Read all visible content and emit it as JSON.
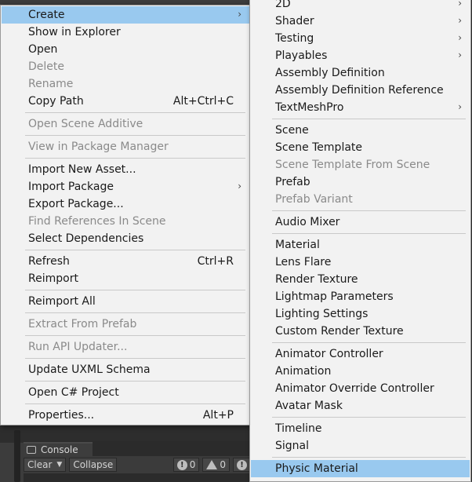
{
  "main_menu": {
    "items": [
      {
        "label": "Create",
        "arrow": "›",
        "highlighted": true
      },
      {
        "label": "Show in Explorer"
      },
      {
        "label": "Open"
      },
      {
        "label": "Delete",
        "disabled": true
      },
      {
        "label": "Rename",
        "disabled": true
      },
      {
        "label": "Copy Path",
        "shortcut": "Alt+Ctrl+C"
      },
      {
        "label": "Open Scene Additive",
        "disabled": true
      },
      {
        "label": "View in Package Manager",
        "disabled": true
      },
      {
        "label": "Import New Asset..."
      },
      {
        "label": "Import Package",
        "arrow": "›"
      },
      {
        "label": "Export Package..."
      },
      {
        "label": "Find References In Scene",
        "disabled": true
      },
      {
        "label": "Select Dependencies"
      },
      {
        "label": "Refresh",
        "shortcut": "Ctrl+R"
      },
      {
        "label": "Reimport"
      },
      {
        "label": "Reimport All"
      },
      {
        "label": "Extract From Prefab",
        "disabled": true
      },
      {
        "label": "Run API Updater...",
        "disabled": true
      },
      {
        "label": "Update UXML Schema"
      },
      {
        "label": "Open C# Project"
      },
      {
        "label": "Properties...",
        "shortcut": "Alt+P"
      }
    ]
  },
  "sub_menu": {
    "items": [
      {
        "label": "2D",
        "arrow": "›"
      },
      {
        "label": "Shader",
        "arrow": "›"
      },
      {
        "label": "Testing",
        "arrow": "›"
      },
      {
        "label": "Playables",
        "arrow": "›"
      },
      {
        "label": "Assembly Definition"
      },
      {
        "label": "Assembly Definition Reference"
      },
      {
        "label": "TextMeshPro",
        "arrow": "›"
      },
      {
        "label": "Scene"
      },
      {
        "label": "Scene Template"
      },
      {
        "label": "Scene Template From Scene",
        "disabled": true
      },
      {
        "label": "Prefab"
      },
      {
        "label": "Prefab Variant",
        "disabled": true
      },
      {
        "label": "Audio Mixer"
      },
      {
        "label": "Material"
      },
      {
        "label": "Lens Flare"
      },
      {
        "label": "Render Texture"
      },
      {
        "label": "Lightmap Parameters"
      },
      {
        "label": "Lighting Settings"
      },
      {
        "label": "Custom Render Texture"
      },
      {
        "label": "Animator Controller"
      },
      {
        "label": "Animation"
      },
      {
        "label": "Animator Override Controller"
      },
      {
        "label": "Avatar Mask"
      },
      {
        "label": "Timeline"
      },
      {
        "label": "Signal"
      },
      {
        "label": "Physic Material",
        "highlighted": true
      }
    ]
  },
  "console": {
    "tab_label": "Console",
    "clear_label": "Clear",
    "clear_caret": "▼",
    "collapse_label": "Collapse",
    "info_count": "0",
    "warning_count": "0"
  },
  "colors": {
    "menu_bg": "#f2f2f2",
    "highlight": "#99c9ef",
    "disabled_text": "#8a8a8a",
    "editor_bg": "#3c3c3c"
  }
}
